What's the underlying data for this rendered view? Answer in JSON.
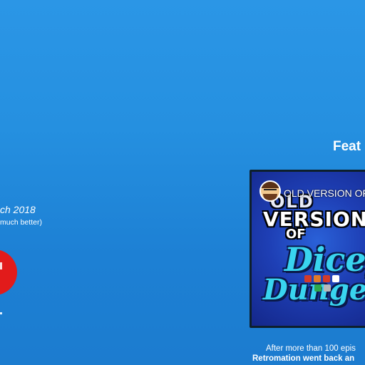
{
  "left_panel": {
    "date_text": "ch 2018",
    "sub_text": "much better)"
  },
  "right_panel": {
    "heading": "Feat",
    "video": {
      "title": "OLD VERSION OF",
      "art": {
        "line_old": "OLD",
        "line_version": "VERSION",
        "line_of": "OF",
        "line_dicey": "Dicey",
        "line_dungeons": "Dungeons"
      }
    },
    "caption_line1": "After more than 100 epis",
    "caption_line2": "Retromation went back an"
  },
  "colors": {
    "background_top": "#2b96e6",
    "background_bottom": "#1c7ccf",
    "badge_red": "#e21b1b",
    "logo_cyan": "#39d4ef"
  },
  "icons": {
    "avatar": "channel-avatar-icon",
    "badge": "red-circle-icon"
  }
}
